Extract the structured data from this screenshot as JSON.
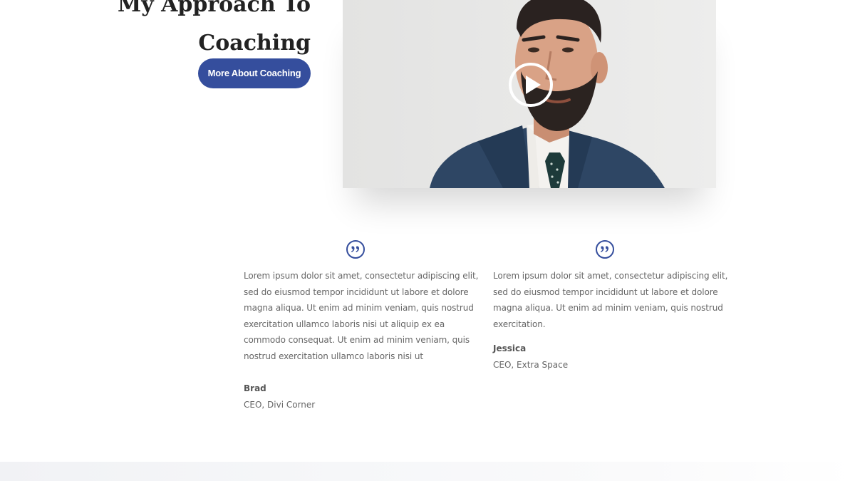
{
  "section": {
    "heading_line1": "My Approach To",
    "heading_line2": "Coaching",
    "cta_label": "More About Coaching"
  },
  "video": {
    "play_icon": "play-icon",
    "poster": "man-in-suit-portrait"
  },
  "testimonials": [
    {
      "icon": "quote-icon",
      "text": "Lorem ipsum dolor sit amet, consectetur adipiscing elit, sed do eiusmod tempor incididunt ut labore et dolore magna aliqua. Ut enim ad minim veniam, quis nostrud exercitation ullamco laboris nisi ut aliquip ex ea commodo consequat. Ut enim ad minim veniam, quis nostrud exercitation ullamco laboris nisi ut",
      "name": "Brad",
      "role": "CEO, Divi Corner"
    },
    {
      "icon": "quote-icon",
      "text": "Lorem ipsum dolor sit amet, consectetur adipiscing elit, sed do eiusmod tempor incididunt ut labore et dolore magna aliqua. Ut enim ad minim veniam, quis nostrud exercitation.",
      "name": "Jessica",
      "role": "CEO, Extra Space"
    }
  ],
  "colors": {
    "accent": "#354e9d",
    "heading": "#222222",
    "body_text": "#666666"
  }
}
